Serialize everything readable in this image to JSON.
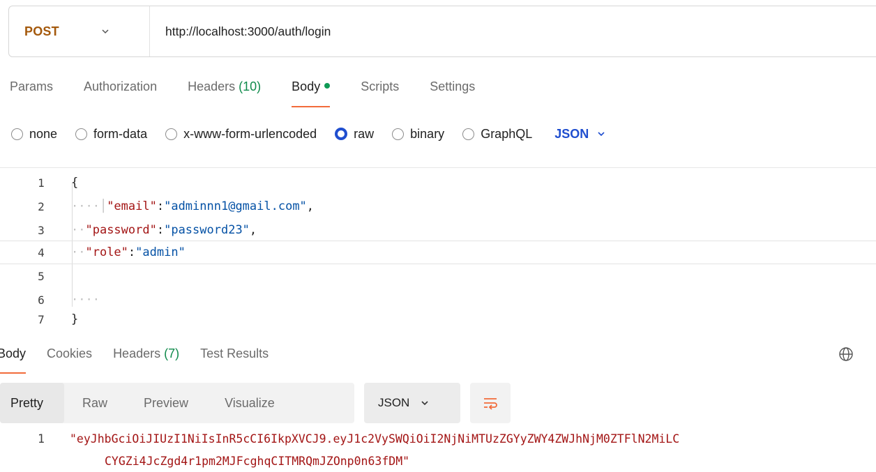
{
  "request": {
    "method": "POST",
    "url": "http://localhost:3000/auth/login"
  },
  "request_tabs": [
    {
      "label": "Params"
    },
    {
      "label": "Authorization"
    },
    {
      "label": "Headers",
      "count": "(10)"
    },
    {
      "label": "Body",
      "active": true
    },
    {
      "label": "Scripts"
    },
    {
      "label": "Settings"
    }
  ],
  "body_types": {
    "none": "none",
    "form_data": "form-data",
    "urlencoded": "x-www-form-urlencoded",
    "raw": "raw",
    "binary": "binary",
    "graphql": "GraphQL",
    "selected": "raw",
    "format": "JSON"
  },
  "editor": {
    "line_numbers": [
      "1",
      "2",
      "3",
      "4",
      "5",
      "6",
      "7"
    ],
    "open_brace": "{",
    "close_brace": "}",
    "email_key": "\"email\"",
    "email_value": "\"adminnn1@gmail.com\"",
    "password_key": "\"password\"",
    "password_value": "\"password23\"",
    "role_key": "\"role\"",
    "role_value": "\"admin\"",
    "colon": ":",
    "comma": ","
  },
  "response_tabs": {
    "body": "Body",
    "cookies": "Cookies",
    "headers": "Headers",
    "headers_count": "(7)",
    "test_results": "Test Results"
  },
  "response_view": {
    "pretty": "Pretty",
    "raw": "Raw",
    "preview": "Preview",
    "visualize": "Visualize",
    "format": "JSON"
  },
  "response_body": {
    "line_number": "1",
    "line1": "\"eyJhbGciOiJIUzI1NiIsInR5cCI6IkpXVCJ9.eyJ1c2VySWQiOiI2NjNiMTUzZGYyZWY4ZWJhNjM0ZTFlN2MiLC",
    "line2": "CYGZi4JcZgd4r1pm2MJFcghqCITMRQmJZOnp0n63fDM\""
  },
  "colors": {
    "method": "#a4590c",
    "accent_tab": "#f26b3a",
    "count": "#0f8a4b",
    "link_blue": "#1f4ecf",
    "json_key": "#a31515",
    "json_string": "#0451a5"
  }
}
